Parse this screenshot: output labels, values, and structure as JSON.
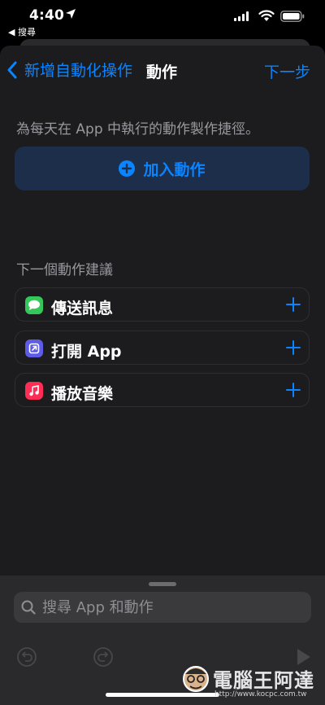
{
  "status_bar": {
    "time": "4:40",
    "back_app": "◀ 搜尋"
  },
  "nav": {
    "back_label": "新增自動化操作",
    "title": "動作",
    "next_label": "下一步"
  },
  "description": "為每天在 App 中執行的動作製作捷徑。",
  "add_action": {
    "label": "加入動作"
  },
  "suggestions": {
    "header": "下一個動作建議",
    "items": [
      {
        "label": "傳送訊息",
        "icon": "messages-icon",
        "color": "#34c759"
      },
      {
        "label": "打開 App",
        "icon": "open-app-icon",
        "color": "#5e5ce6"
      },
      {
        "label": "播放音樂",
        "icon": "music-icon",
        "color": "#ff2d55"
      }
    ]
  },
  "search": {
    "placeholder": "搜尋 App 和動作"
  },
  "toolbar": {
    "undo": "undo-icon",
    "redo": "redo-icon",
    "play": "play-icon"
  },
  "watermark": {
    "text": "電腦王阿達",
    "url": "http://www.kocpc.com.tw"
  },
  "colors": {
    "accent": "#0a84ff",
    "sheet_bg": "#1c1c1e",
    "drawer_bg": "#2a2a2d"
  }
}
